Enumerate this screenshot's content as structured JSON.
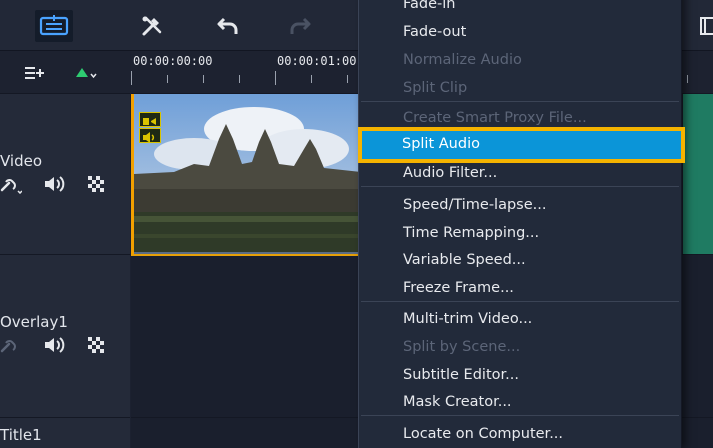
{
  "tracks": [
    {
      "label": "Video"
    },
    {
      "label": "Overlay1"
    },
    {
      "label": "Title1"
    }
  ],
  "ruler": {
    "timecodes": [
      "00:00:00:00",
      "00:00:01:00"
    ]
  },
  "context_menu": {
    "items": [
      {
        "label": "Fade-in",
        "enabled": true
      },
      {
        "label": "Fade-out",
        "enabled": true
      },
      {
        "label": "Normalize Audio",
        "enabled": false
      },
      {
        "label": "Split Clip",
        "enabled": false
      },
      {
        "label": "Create Smart Proxy File...",
        "enabled": false
      },
      {
        "label": "Split Audio",
        "enabled": true,
        "highlighted": true
      },
      {
        "label": "Audio Filter...",
        "enabled": true
      },
      {
        "label": "Speed/Time-lapse...",
        "enabled": true
      },
      {
        "label": "Time Remapping...",
        "enabled": true
      },
      {
        "label": "Variable Speed...",
        "enabled": true
      },
      {
        "label": "Freeze Frame...",
        "enabled": true
      },
      {
        "label": "Multi-trim Video...",
        "enabled": true
      },
      {
        "label": "Split by Scene...",
        "enabled": false
      },
      {
        "label": "Subtitle Editor...",
        "enabled": true
      },
      {
        "label": "Mask Creator...",
        "enabled": true
      },
      {
        "label": "Locate on Computer...",
        "enabled": true
      }
    ]
  },
  "colors": {
    "highlight_bg": "#0b95d8",
    "highlight_border": "#f5b300",
    "clip_border": "#f2a000",
    "add_track_accent": "#2ecc71",
    "active_tool": "#4aa3ff"
  },
  "icons": {
    "toolbar": [
      "timeline-view-icon",
      "tools-icon",
      "undo-icon",
      "redo-icon"
    ],
    "track_tools": [
      "track-manager-icon",
      "add-marker-icon"
    ],
    "track_controls": [
      "link-icon",
      "audio-icon",
      "grid-icon"
    ]
  }
}
